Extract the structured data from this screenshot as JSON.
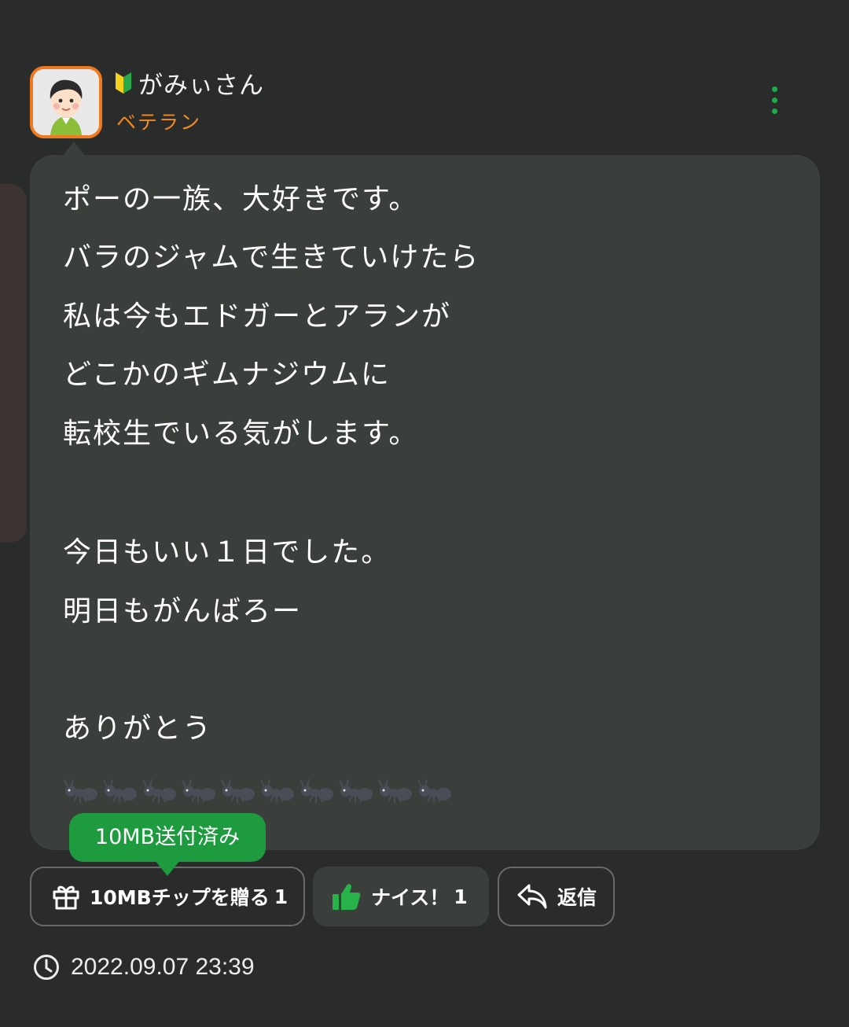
{
  "post": {
    "user_name": "がみぃさん",
    "user_rank": "ベテラン",
    "message_lines": [
      "ポーの一族、大好きです。",
      "バラのジャムで生きていけたら",
      "私は今もエドガーとアランが",
      "どこかのギムナジウムに",
      "転校生でいる気がします。",
      "今日もいい１日でした。",
      "明日もがんばろー",
      "ありがとう"
    ],
    "emoji_row": "🐜🐜🐜🐜🐜🐜🐜🐜🐜🐜",
    "sent_badge": "10MB送付済み",
    "actions": {
      "tip_label": "10MBチップを贈る",
      "tip_count": "1",
      "nice_label": "ナイス！",
      "nice_count": "1",
      "reply_label": "返信"
    },
    "timestamp": "2022.09.07 23:39"
  },
  "colors": {
    "background": "#2a2c2b",
    "bubble": "#3b3f3c",
    "accent_green": "#1e9b3f",
    "rank_orange": "#f08a24",
    "avatar_border": "#f07a1d"
  },
  "icons": {
    "user_badge": "beginner-mark-icon",
    "more": "more-vertical-icon",
    "tip": "gift-icon",
    "nice": "thumbs-up-icon",
    "reply": "reply-icon",
    "time": "clock-icon"
  }
}
